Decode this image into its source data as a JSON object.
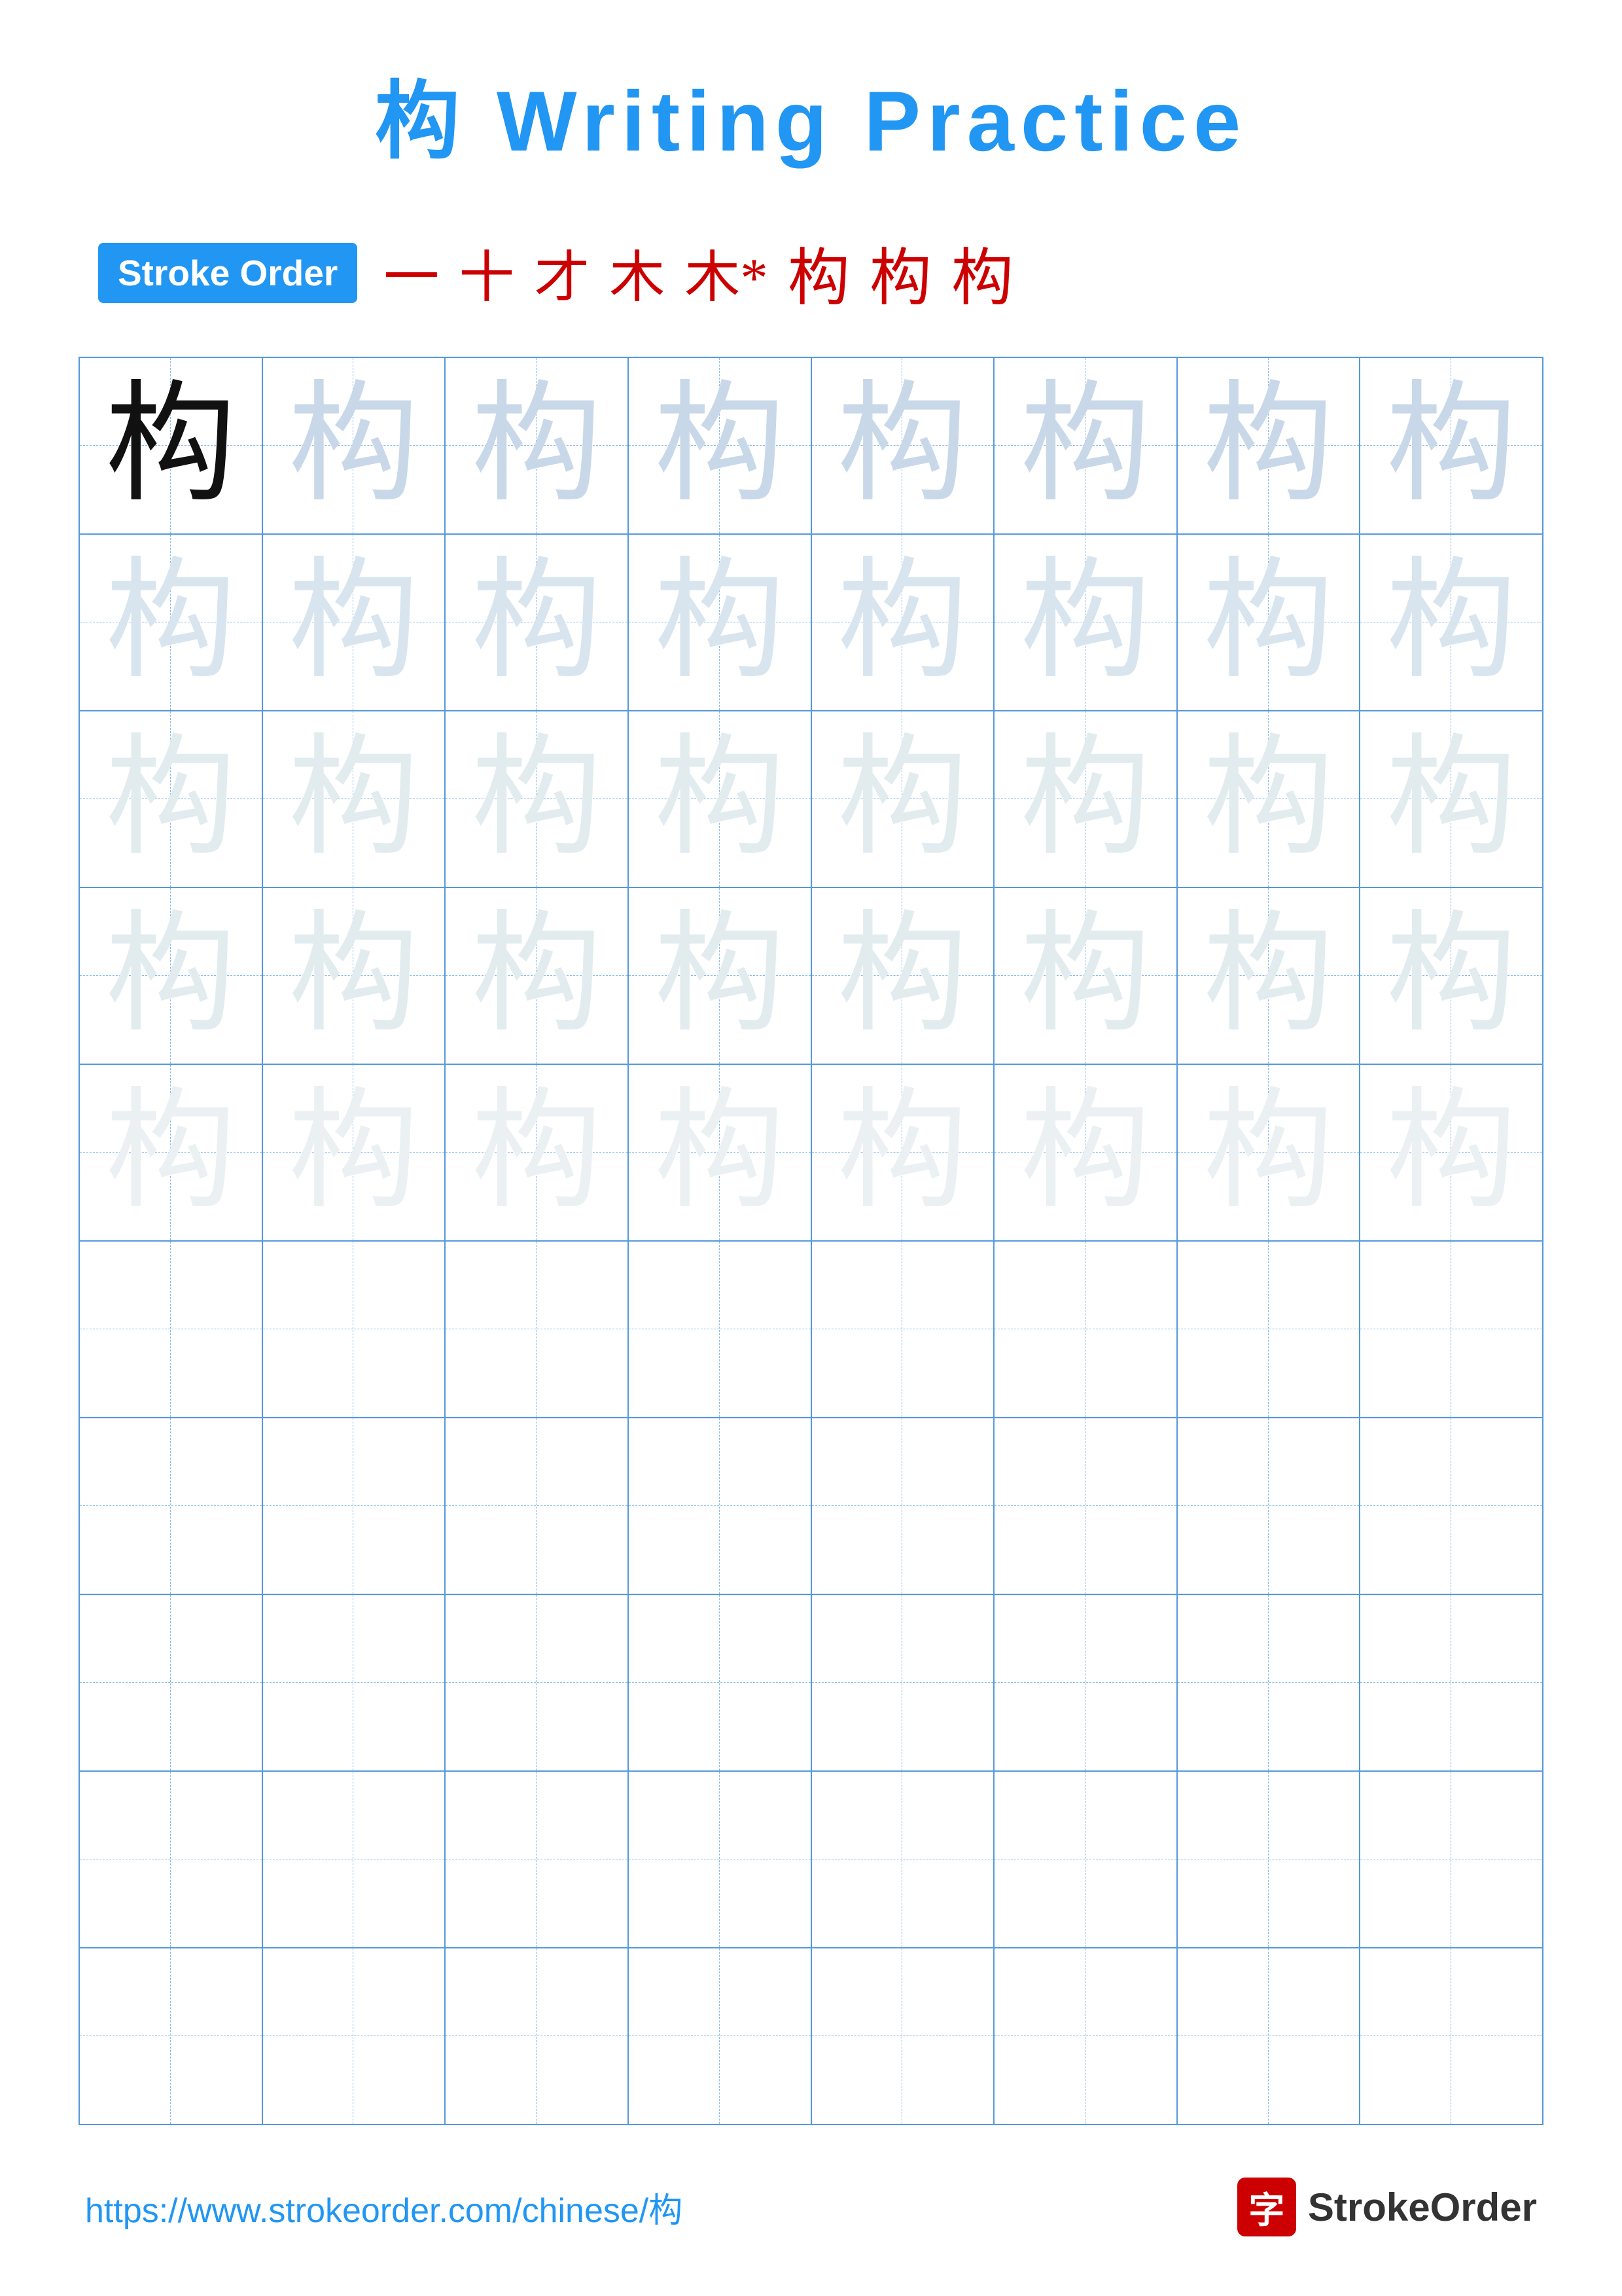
{
  "page": {
    "title": "构 Writing Practice",
    "character": "构",
    "stroke_order_label": "Stroke Order",
    "stroke_sequence": [
      "一",
      "十",
      "才",
      "木",
      "木*",
      "构",
      "构",
      "构"
    ],
    "footer_url": "https://www.strokeorder.com/chinese/构",
    "footer_logo_text": "StrokeOrder",
    "footer_logo_char": "字",
    "rows": 10,
    "cols": 8,
    "practice_rows_with_chars": 5,
    "practice_rows_empty": 5
  }
}
